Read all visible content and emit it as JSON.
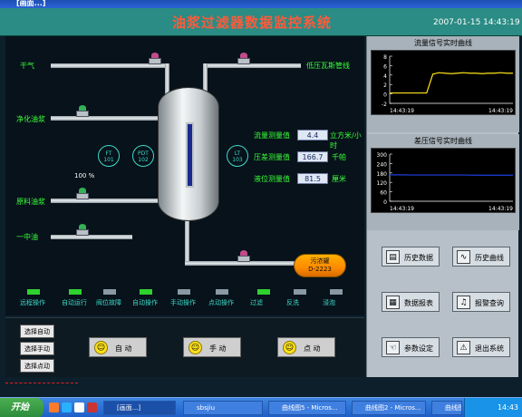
{
  "window": {
    "title": "[画面...]"
  },
  "header": {
    "title": "油浆过滤器数据监控系统",
    "datetime": "2007-01-15 14:43:19"
  },
  "process": {
    "lines": {
      "dry_gas": "干气",
      "clean_oil": "净化油浆",
      "raw_oil": "原料油浆",
      "mid_oil": "一中油",
      "low_gas_line": "低压瓦斯管线"
    },
    "instruments": {
      "ft": [
        "FT",
        "101"
      ],
      "pdt": [
        "PDT",
        "102"
      ],
      "lt": [
        "LT",
        "103"
      ]
    },
    "valve_percent": "100 %",
    "measurements": [
      {
        "label": "流量测量值",
        "value": "4.4",
        "unit": "立方米/小时"
      },
      {
        "label": "压差测量值",
        "value": "166.7",
        "unit": "千帕"
      },
      {
        "label": "液位测量值",
        "value": "81.5",
        "unit": "厘米"
      }
    ],
    "dirt_tank": {
      "name": "污浓罐",
      "code": "D-2223"
    },
    "status_leds": [
      {
        "label": "远程操作",
        "color": "#2fd12f"
      },
      {
        "label": "自动运行",
        "color": "#2fd12f"
      },
      {
        "label": "阀位故障",
        "color": "#8a9aa4"
      },
      {
        "label": "自动操作",
        "color": "#2fd12f"
      },
      {
        "label": "手动操作",
        "color": "#8a9aa4"
      },
      {
        "label": "点动操作",
        "color": "#8a9aa4"
      },
      {
        "label": "过滤",
        "color": "#2fd12f"
      },
      {
        "label": "反洗",
        "color": "#8a9aa4"
      },
      {
        "label": "浸泡",
        "color": "#8a9aa4"
      }
    ]
  },
  "controls": {
    "mode_buttons": [
      "选择自动",
      "选择手动",
      "选择点动"
    ],
    "big_buttons": [
      "自  动",
      "手  动",
      "点  动"
    ]
  },
  "charts": [
    {
      "title": "流量信号实时曲线",
      "time_label": "14:43:19",
      "chart_data": {
        "type": "line",
        "ylim": [
          -2,
          8
        ],
        "yticks": [
          "8",
          "6",
          "4",
          "2",
          "0",
          "-2"
        ],
        "x": [
          0,
          1,
          2,
          3,
          4,
          5,
          6,
          7,
          8,
          9,
          10,
          11,
          12,
          13,
          14,
          15,
          16,
          17,
          18,
          19,
          20
        ],
        "series": [
          {
            "values": [
              0.2,
              0.2,
              0.2,
              0.2,
              0.2,
              0.2,
              0.2,
              4.2,
              4.5,
              4.4,
              4.3,
              4.4,
              4.5,
              4.4,
              4.4,
              4.3,
              4.4,
              4.4,
              4.5,
              4.4,
              4.4
            ],
            "color": "#ffe21a"
          }
        ]
      }
    },
    {
      "title": "差压信号实时曲线",
      "time_label": "14:43:19",
      "chart_data": {
        "type": "line",
        "ylim": [
          0,
          300
        ],
        "yticks": [
          "300",
          "240",
          "180",
          "120",
          "60",
          "0"
        ],
        "x": [
          0,
          1,
          2,
          3,
          4,
          5,
          6,
          7,
          8,
          9,
          10
        ],
        "series": [
          {
            "values": [
              168,
              168,
              167,
              167,
              167,
              167,
              167,
              166,
              166,
              166,
              166
            ],
            "color": "#1f3fe0"
          }
        ]
      }
    }
  ],
  "functions": [
    {
      "label": "历史数据",
      "icon": "document-icon"
    },
    {
      "label": "历史曲线",
      "icon": "curve-icon"
    },
    {
      "label": "数据报表",
      "icon": "report-icon"
    },
    {
      "label": "报警查询",
      "icon": "bell-icon"
    },
    {
      "label": "参数设定",
      "icon": "hand-icon"
    },
    {
      "label": "退出系统",
      "icon": "warning-icon"
    }
  ],
  "taskbar": {
    "start": "开始",
    "items": [
      "[画面...]",
      "sbsjiu",
      "曲线图5 - Micros...",
      "曲线图2 - Micros...",
      "曲线图3 - Micros..."
    ],
    "clock": "14:43"
  }
}
